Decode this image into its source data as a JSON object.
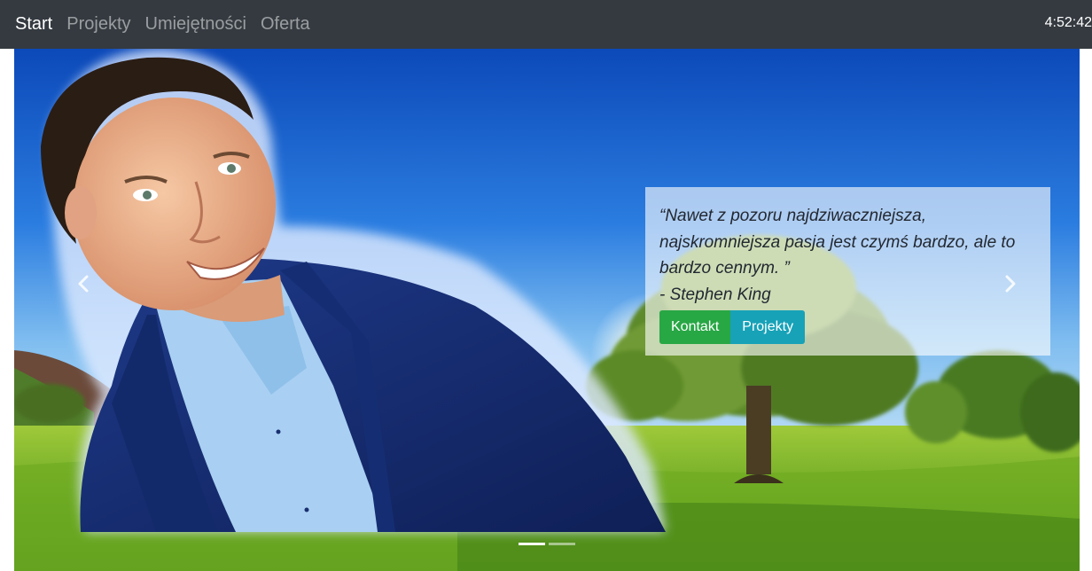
{
  "navbar": {
    "items": [
      {
        "label": "Start",
        "active": true
      },
      {
        "label": "Projekty",
        "active": false
      },
      {
        "label": "Umiejętności",
        "active": false
      },
      {
        "label": "Oferta",
        "active": false
      }
    ],
    "clock": "4:52:42"
  },
  "carousel": {
    "prev_icon": "chevron-left-icon",
    "next_icon": "chevron-right-icon",
    "slides": 2,
    "active_slide": 1,
    "caption": {
      "quote": "“Nawet z pozoru najdziwaczniejsza, najskromniejsza pasja jest czymś bardzo, ale to bardzo cennym. ”",
      "author": "- Stephen King",
      "buttons": {
        "contact": "Kontakt",
        "projects": "Projekty"
      }
    }
  },
  "colors": {
    "navbar_bg": "#343a40",
    "success": "#28a745",
    "info": "#17a2b8",
    "sky": "#1f6fd1",
    "grass": "#7fb62c"
  }
}
